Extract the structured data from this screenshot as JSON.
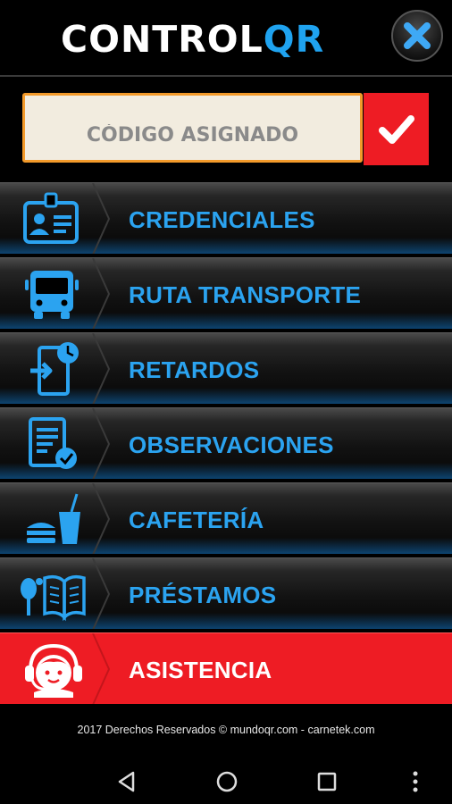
{
  "header": {
    "logo_part1": "CONTROL",
    "logo_part2": "QR",
    "close_icon": "close-icon"
  },
  "code": {
    "placeholder": "CÓDIGO ASIGNADO",
    "confirm_icon": "checkmark-icon"
  },
  "menu": {
    "items": [
      {
        "label": "CREDENCIALES",
        "icon": "id-card-icon"
      },
      {
        "label": "RUTA TRANSPORTE",
        "icon": "bus-icon"
      },
      {
        "label": "RETARDOS",
        "icon": "late-clock-icon"
      },
      {
        "label": "OBSERVACIONES",
        "icon": "checklist-icon"
      },
      {
        "label": "CAFETERÍA",
        "icon": "food-drink-icon"
      },
      {
        "label": "PRÉSTAMOS",
        "icon": "loans-icon"
      },
      {
        "label": "ASISTENCIA",
        "icon": "support-agent-icon"
      }
    ]
  },
  "footer": {
    "text": "2017 Derechos Reservados © mundoqr.com - carnetek.com"
  },
  "colors": {
    "accent_blue": "#2ba3f0",
    "active_red": "#ee1c24",
    "input_border": "#f39a2a"
  }
}
